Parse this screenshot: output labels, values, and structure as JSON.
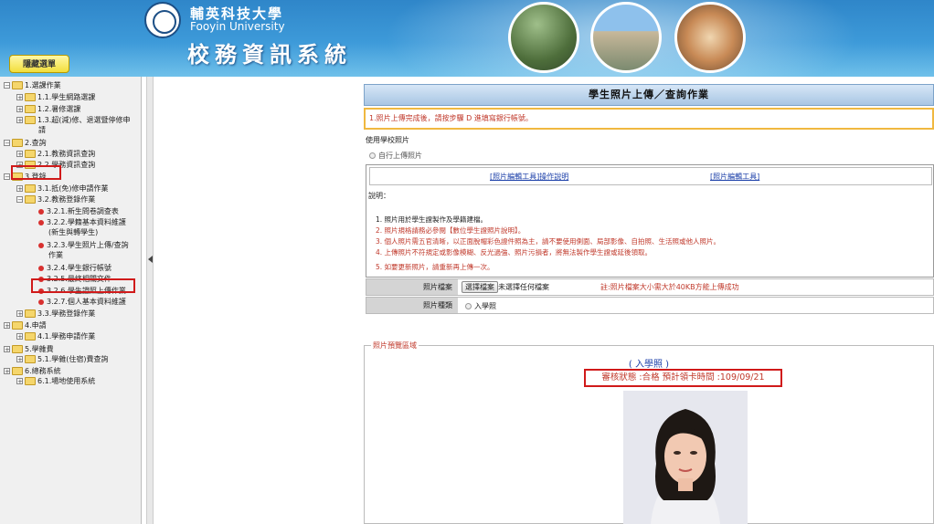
{
  "header": {
    "university_cn": "輔英科技大學",
    "university_en": "Fooyin University",
    "system_title": "校務資訊系統",
    "menu_tag": "隱藏選單"
  },
  "sidebar": {
    "items": [
      {
        "label": "1.選課作業",
        "level": 0
      },
      {
        "label": "1.1.學生網路選課",
        "level": 1
      },
      {
        "label": "1.2.暑修選課",
        "level": 1
      },
      {
        "label": "1.3.超(減)修、退選暨停修申",
        "level": 1
      },
      {
        "label": "請",
        "level": 1
      },
      {
        "label": "2.查詢",
        "level": 0
      },
      {
        "label": "2.1.教務資訊查詢",
        "level": 1
      },
      {
        "label": "2.2.學務資訊查詢",
        "level": 1
      },
      {
        "label": "3.登錄",
        "level": 0
      },
      {
        "label": "3.1.抵(免)修申請作業",
        "level": 1
      },
      {
        "label": "3.2.教務登錄作業",
        "level": 1
      },
      {
        "label": "3.2.1.新生問卷調查表",
        "level": 2
      },
      {
        "label": "3.2.2.學籍基本資料維護",
        "level": 2
      },
      {
        "label": "(新生與轉學生)",
        "level": 2
      },
      {
        "label": "3.2.3.學生照片上傳/查詢",
        "level": 2
      },
      {
        "label": "作業",
        "level": 2
      },
      {
        "label": "3.2.4.學生銀行帳號",
        "level": 2
      },
      {
        "label": "3.2.5.最終相關文件",
        "level": 2
      },
      {
        "label": "3.2.6.學生證照上傳作業",
        "level": 2
      },
      {
        "label": "3.2.7.個人基本資料維護",
        "level": 2
      },
      {
        "label": "3.3.學務登錄作業",
        "level": 1
      },
      {
        "label": "4.申請",
        "level": 0
      },
      {
        "label": "4.1.學務申請作業",
        "level": 1
      },
      {
        "label": "5.學雜費",
        "level": 0
      },
      {
        "label": "5.1.學雜(住宿)費查詢",
        "level": 1
      },
      {
        "label": "6.總務系統",
        "level": 0
      },
      {
        "label": "6.1.場地使用系統",
        "level": 1
      }
    ]
  },
  "main": {
    "page_title": "學生照片上傳／查詢作業",
    "notice": "1.照片上傳完成後，請按步驟 D 進填寫銀行帳號。",
    "use_school_photo": "使用學校照片",
    "self_upload": "自行上傳照片",
    "link_tool_guide": "[照片編輯工具]操作說明",
    "link_tool": "[照片編輯工具]",
    "instructions_title": "說明：",
    "instructions": [
      "1. 照片用於學生證製作及學籍建檔。",
      "2. 照片規格請務必參閱【數位學生證照片說明】。",
      "3. 個人照片需五官清晰，以正面脫帽彩色證件照為主，請不要使用側面、局部影像、自拍照、生活照或他人照片。",
      "4. 上傳照片不符規定或影像模糊、反光過強、照片污損者，將無法製作學生證或延後領取。",
      "5. 如要更新照片，請重新再上傳一次。"
    ],
    "photo_file_label": "照片檔案",
    "choose_file_button": "選擇檔案",
    "no_file_text": "未選擇任何檔案",
    "size_note": "註:照片檔案大小需大於40KB方能上傳成功",
    "photo_type_label": "照片種類",
    "photo_type_option": "入學照",
    "preview_legend": "照片預覽區域",
    "preview_heading": "( 入學照 )",
    "review_status": "審核狀態 :合格  預計領卡時間 :109/09/21"
  }
}
